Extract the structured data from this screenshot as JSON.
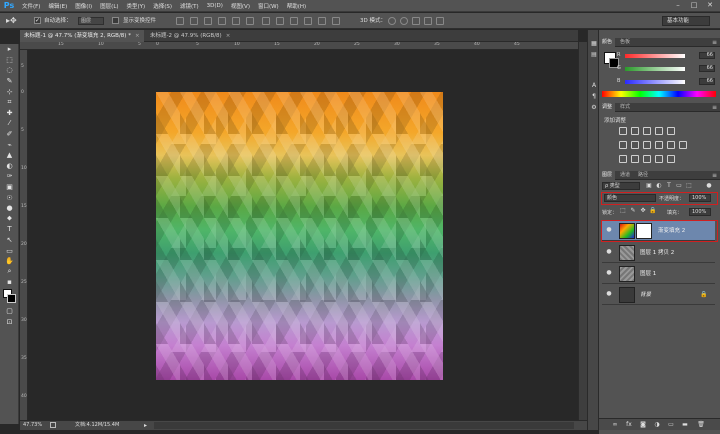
{
  "menubar": {
    "logo": "Ps",
    "items": [
      "文件(F)",
      "编辑(E)",
      "图像(I)",
      "图层(L)",
      "类型(Y)",
      "选择(S)",
      "滤镜(T)",
      "3D(D)",
      "视图(V)",
      "窗口(W)",
      "帮助(H)"
    ],
    "minimize": "–",
    "maximize": "□",
    "close": "✕"
  },
  "options": {
    "auto_select_label": "自动选择：",
    "auto_select_target": "图层",
    "show_transform_label": "显示变换控件",
    "mode_3d_label": "3D 模式：",
    "workspace": "基本功能"
  },
  "tabs": [
    {
      "label": "未标题-1 @ 47.7% (渐变填充 2, RGB/8) *",
      "close": "×"
    },
    {
      "label": "未标题-2 @ 47.9% (RGB/8)",
      "close": "×"
    }
  ],
  "ruler_top": [
    "15",
    "10",
    "5",
    "0",
    "5",
    "10",
    "15",
    "20",
    "25",
    "30",
    "35",
    "40",
    "45"
  ],
  "ruler_left": [
    "5",
    "0",
    "5",
    "10",
    "15",
    "20",
    "25",
    "30",
    "35",
    "40"
  ],
  "toolbox": [
    "▸",
    "⬚",
    "◌",
    "✎",
    "⊹",
    "⌗",
    "✚",
    "⁄",
    "✐",
    "⌁",
    "▲",
    "◐",
    "✑",
    "▣",
    "☉",
    "●",
    "⬥",
    "T",
    "↖",
    "▭",
    "✋",
    "⌕",
    "▪",
    "◧",
    "▢",
    "⊡"
  ],
  "status": {
    "zoom": "47.73%",
    "doc": "文档:4.12M/15.4M"
  },
  "icon_strip": [
    "▦",
    "▤",
    "A",
    "¶",
    "⚙"
  ],
  "color_panel": {
    "tabs": [
      "颜色",
      "色板"
    ],
    "menu": "≡",
    "channels": [
      {
        "label": "R",
        "value": "66"
      },
      {
        "label": "G",
        "value": "66"
      },
      {
        "label": "B",
        "value": "66"
      }
    ]
  },
  "adjust_panel": {
    "tabs": [
      "调整",
      "样式"
    ],
    "title": "添加调整"
  },
  "layers_panel": {
    "tabs": [
      "图层",
      "通道",
      "路径"
    ],
    "kind_filter": "ρ 类型",
    "blend_mode": "颜色",
    "opacity_label": "不透明度：",
    "opacity_value": "100%",
    "lock_label": "锁定：",
    "fill_label": "填充：",
    "fill_value": "100%",
    "layers": [
      {
        "name": "渐变填充 2",
        "selected": true
      },
      {
        "name": "图层 1 拷贝 2",
        "selected": false
      },
      {
        "name": "图层 1",
        "selected": false
      },
      {
        "name": "背景",
        "selected": false,
        "locked": true
      }
    ],
    "bottom_icons": [
      "∞",
      "fx",
      "◙",
      "◑",
      "▭",
      "▬",
      "🗑"
    ]
  },
  "colors": {
    "panel_bg": "#535353",
    "canvas_bg": "#282828",
    "selection": "#6d87ad",
    "highlight_box": "#d02020"
  }
}
